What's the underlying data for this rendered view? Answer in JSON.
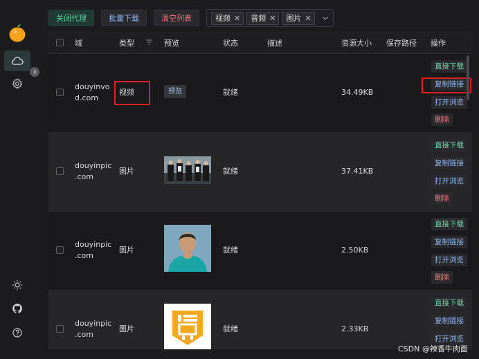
{
  "toolbar": {
    "close_proxy": "关闭代理",
    "batch_download": "批量下载",
    "clear_list": "清空列表",
    "filters": [
      "视频",
      "音频",
      "图片"
    ]
  },
  "table": {
    "headers": {
      "domain": "域",
      "type": "类型",
      "preview": "预览",
      "status": "状态",
      "description": "描述",
      "size": "资源大小",
      "save_path": "保存路径",
      "actions": "操作"
    },
    "rows": [
      {
        "domain_l1": "douyinvo",
        "domain_l2": "d.com",
        "type": "视频",
        "preview": "预览",
        "status": "就绪",
        "size": "34.49KB"
      },
      {
        "domain_l1": "douyinpic",
        "domain_l2": ".com",
        "type": "图片",
        "preview": "",
        "status": "就绪",
        "size": "37.41KB"
      },
      {
        "domain_l1": "douyinpic",
        "domain_l2": ".com",
        "type": "图片",
        "preview": "",
        "status": "就绪",
        "size": "2.50KB"
      },
      {
        "domain_l1": "douyinpic",
        "domain_l2": ".com",
        "type": "图片",
        "preview": "",
        "status": "就绪",
        "size": "2.33KB"
      }
    ],
    "actions": {
      "download": "直接下载",
      "copy": "复制链接",
      "open": "打开浏览",
      "delete": "删除"
    }
  },
  "watermark": "CSDN @辣香牛肉面",
  "colors": {
    "accent_green": "#5fd3a0",
    "link_blue": "#8fbaf0",
    "danger_red": "#f07a7a",
    "highlight_box": "#e02020"
  },
  "icons": [
    "cloud-icon",
    "gear-icon",
    "sun-icon",
    "github-icon",
    "help-icon",
    "chevron-right-icon",
    "funnel-icon",
    "chevron-down-icon"
  ]
}
